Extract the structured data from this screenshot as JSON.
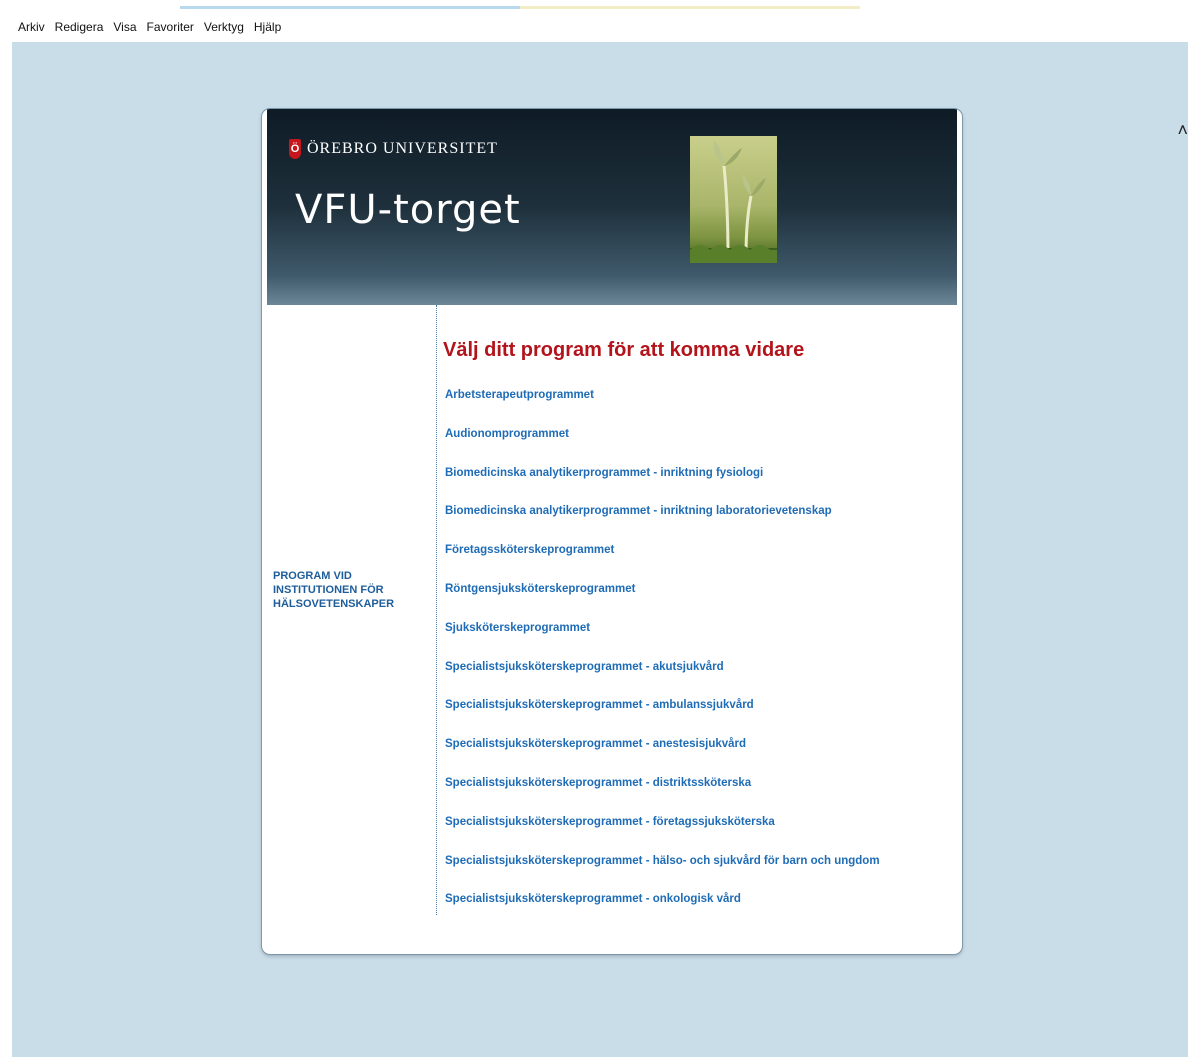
{
  "menu": {
    "items": [
      "Arkiv",
      "Redigera",
      "Visa",
      "Favoriter",
      "Verktyg",
      "Hjälp"
    ]
  },
  "header": {
    "university": "ÖREBRO UNIVERSITET",
    "logo_letter": "Ö",
    "site_title": "VFU-torget"
  },
  "sidebar": {
    "label": "PROGRAM VID INSTITUTIONEN FÖR HÄLSOVETENSKAPER"
  },
  "main": {
    "heading": "Välj ditt program för att komma vidare",
    "programs": [
      "Arbetsterapeutprogrammet",
      "Audionomprogrammet",
      "Biomedicinska analytikerprogrammet - inriktning fysiologi",
      "Biomedicinska analytikerprogrammet - inriktning laboratorievetenskap",
      "Företagssköterskeprogrammet",
      "Röntgensjuksköterskeprogrammet",
      "Sjuksköterskeprogrammet",
      "Specialistsjuksköterskeprogrammet - akutsjukvård",
      "Specialistsjuksköterskeprogrammet - ambulanssjukvård",
      "Specialistsjuksköterskeprogrammet - anestesisjukvård",
      "Specialistsjuksköterskeprogrammet - distriktssköterska",
      "Specialistsjuksköterskeprogrammet - företagssjuksköterska",
      "Specialistsjuksköterskeprogrammet - hälso- och sjukvård för barn och ungdom",
      "Specialistsjuksköterskeprogrammet - onkologisk vård"
    ]
  },
  "colors": {
    "page_background": "#c9dde9",
    "header_dark": "#0e1b25",
    "heading_red": "#b3141c",
    "link_blue": "#1f6cb6",
    "label_blue": "#1e5d9a",
    "logo_red": "#c4161c"
  },
  "icons": {
    "scroll_up": "chevron-up-icon",
    "scroll_down": "chevron-down-icon"
  }
}
